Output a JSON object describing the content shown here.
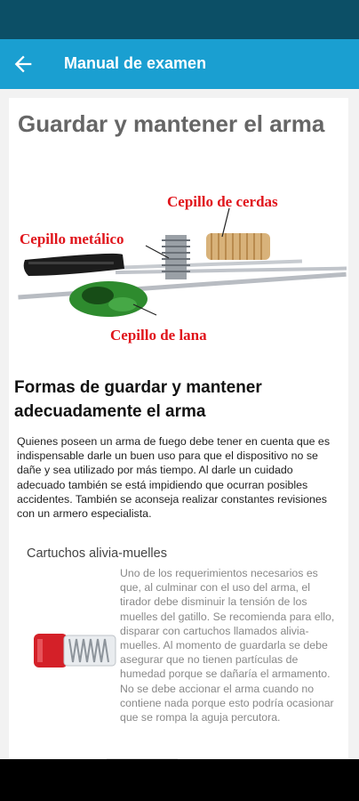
{
  "header": {
    "title": "Manual de examen",
    "back_icon": "arrow-back-icon"
  },
  "colors": {
    "status_bar": "#0c4f66",
    "app_bar": "#1a9fd1",
    "label_red": "#e0141b"
  },
  "article": {
    "title": "Guardar y mantener el arma",
    "figure_labels": {
      "brush_bristle": "Cepillo de cerdas",
      "brush_metal": "Cepillo metálico",
      "brush_wool": "Cepillo de lana"
    },
    "section_title": "Formas de guardar y mantener adecuadamente el arma",
    "intro": "Quienes poseen un arma de fuego debe tener en cuenta que es indispensable darle un buen uso para que el dispositivo no se dañe y sea utilizado por más tiempo. Al darle un cuidado adecuado también se está impidiendo que ocurran posibles accidentes. También se aconseja realizar constantes revisiones con un armero especialista.",
    "subsection_title": "Cartuchos alivia-muelles",
    "subsection_text": "Uno de los requerimientos necesarios es que, al culminar con el uso del arma, el tirador debe disminuir la tensión de los muelles del gatillo. Se recomienda para ello, disparar con cartuchos llamados alivia-muelles. Al momento de guardarla se debe asegurar que no tienen partículas de humedad porque se dañaría el armamento. No se debe accionar el arma cuando no contiene nada porque esto podría ocasionar que se rompa la aguja percutora."
  }
}
